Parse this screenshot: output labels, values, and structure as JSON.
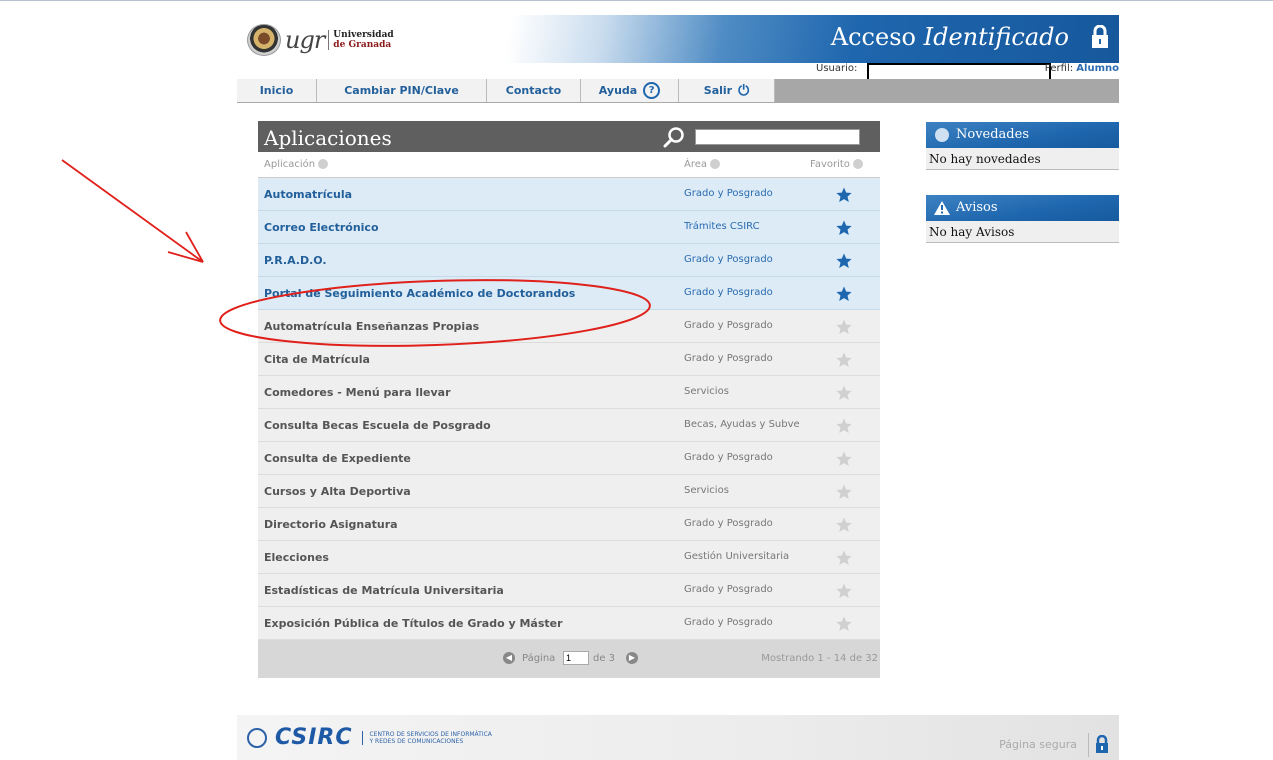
{
  "header": {
    "uni_line1": "Universidad",
    "uni_line2": "de Granada",
    "logo_word": "ugr",
    "banner_title_plain": "Acceso ",
    "banner_title_italic": "Identificado",
    "user_label": "Usuario:",
    "perfil_label": "Perfil:",
    "perfil_value": "Alumno"
  },
  "nav": {
    "items": [
      "Inicio",
      "Cambiar PIN/Clave",
      "Contacto",
      "Ayuda",
      "Salir"
    ]
  },
  "apps": {
    "title": "Aplicaciones",
    "search_value": "",
    "col_app": "Aplicación",
    "col_area": "Área",
    "col_fav": "Favorito",
    "rows": [
      {
        "name": "Automatrícula",
        "area": "Grado y Posgrado",
        "favorite": true
      },
      {
        "name": "Correo Electrónico",
        "area": "Trámites CSIRC",
        "favorite": true
      },
      {
        "name": "P.R.A.D.O.",
        "area": "Grado y Posgrado",
        "favorite": true
      },
      {
        "name": "Portal de Seguimiento Académico de Doctorandos",
        "area": "Grado y Posgrado",
        "favorite": true
      },
      {
        "name": "Automatrícula Enseñanzas Propias",
        "area": "Grado y Posgrado",
        "favorite": false
      },
      {
        "name": "Cita de Matrícula",
        "area": "Grado y Posgrado",
        "favorite": false
      },
      {
        "name": "Comedores - Menú para llevar",
        "area": "Servicios",
        "favorite": false
      },
      {
        "name": "Consulta Becas Escuela de Posgrado",
        "area": "Becas, Ayudas y Subve",
        "favorite": false
      },
      {
        "name": "Consulta de Expediente",
        "area": "Grado y Posgrado",
        "favorite": false
      },
      {
        "name": "Cursos y Alta Deportiva",
        "area": "Servicios",
        "favorite": false
      },
      {
        "name": "Directorio Asignatura",
        "area": "Grado y Posgrado",
        "favorite": false
      },
      {
        "name": "Elecciones",
        "area": "Gestión Universitaria",
        "favorite": false
      },
      {
        "name": "Estadísticas de Matrícula Universitaria",
        "area": "Grado y Posgrado",
        "favorite": false
      },
      {
        "name": "Exposición Pública de Títulos de Grado y Máster",
        "area": "Grado y Posgrado",
        "favorite": false
      }
    ],
    "pager": {
      "page_label": "Página",
      "page_value": "1",
      "of_label": "de 3",
      "showing": "Mostrando 1 - 14 de 32"
    }
  },
  "widgets": {
    "news_title": "Novedades",
    "news_body": "No hay novedades",
    "alerts_title": "Avisos",
    "alerts_body": "No hay Avisos"
  },
  "footer": {
    "csirc": "CSIRC",
    "desc_line1": "CENTRO DE SERVICIOS DE INFORMÁTICA",
    "desc_line2": "Y REDES DE COMUNICACIONES",
    "secure": "Página segura"
  },
  "colors": {
    "brand_blue": "#1e66ae",
    "fav_row_bg": "#dcebf6",
    "star_active": "#1e66ae",
    "star_inactive": "#d0d0d0",
    "annotation": "#e0201a"
  }
}
